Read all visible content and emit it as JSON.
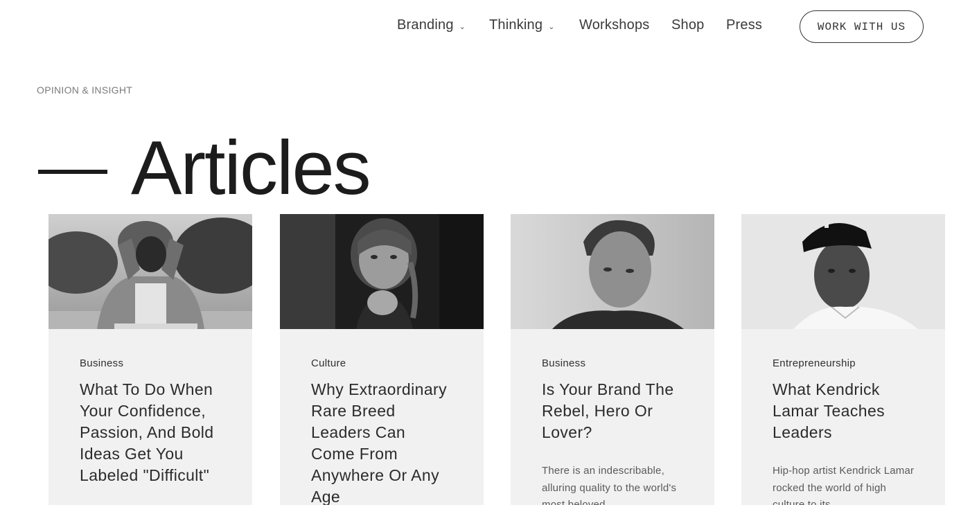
{
  "nav": {
    "items": [
      {
        "label": "Branding",
        "has_dropdown": true
      },
      {
        "label": "Thinking",
        "has_dropdown": true
      },
      {
        "label": "Workshops",
        "has_dropdown": false
      },
      {
        "label": "Shop",
        "has_dropdown": false
      },
      {
        "label": "Press",
        "has_dropdown": false
      }
    ],
    "cta_label": "WORK WITH US"
  },
  "header": {
    "eyebrow": "OPINION & INSIGHT",
    "title": "Articles"
  },
  "articles": [
    {
      "category": "Business",
      "title": "What To Do When Your Confidence, Passion, And Bold Ideas Get You Labeled \"Difficult\"",
      "excerpt": ""
    },
    {
      "category": "Culture",
      "title": "Why Extraordinary Rare Breed Leaders Can Come From Anywhere Or Any Age",
      "excerpt": ""
    },
    {
      "category": "Business",
      "title": "Is Your Brand The Rebel, Hero Or Lover?",
      "excerpt": "There is an indescribable, alluring quality to the world's most beloved"
    },
    {
      "category": "Entrepreneurship",
      "title": "What Kendrick Lamar Teaches Leaders",
      "excerpt": "Hip-hop artist Kendrick Lamar rocked the world of high culture to its"
    }
  ],
  "icons": {
    "dropdown": "chevron-down-icon"
  }
}
